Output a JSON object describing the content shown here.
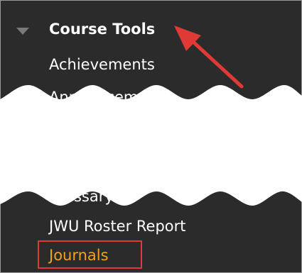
{
  "course_menu": {
    "section_title": "Course Tools",
    "items": [
      {
        "label": "Achievements"
      },
      {
        "label": "Announcements"
      },
      {
        "label": "Glossary"
      },
      {
        "label": "JWU Roster Report"
      },
      {
        "label": "Journals"
      }
    ]
  },
  "colors": {
    "menu_background": "#2b2b2b",
    "highlight_link": "#f3a21b",
    "annotation_red": "#e03a36"
  }
}
